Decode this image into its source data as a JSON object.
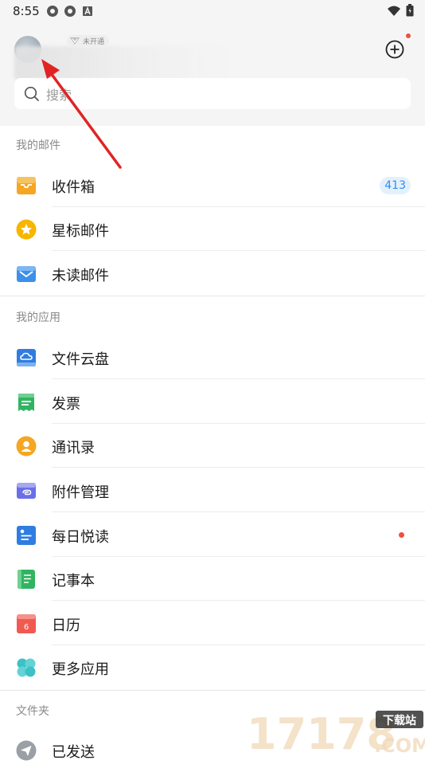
{
  "status_bar": {
    "time": "8:55"
  },
  "header": {
    "vip_badge": "未开通",
    "search_placeholder": "搜索"
  },
  "sections": {
    "my_mail": {
      "title": "我的邮件",
      "items": [
        {
          "label": "收件箱",
          "badge": "413",
          "icon": "inbox-tray-icon",
          "color": "#f5a623"
        },
        {
          "label": "星标邮件",
          "icon": "star-icon",
          "color": "#f7b500"
        },
        {
          "label": "未读邮件",
          "icon": "envelope-icon",
          "color": "#3d8fea"
        }
      ]
    },
    "my_apps": {
      "title": "我的应用",
      "items": [
        {
          "label": "文件云盘",
          "icon": "cloud-drive-icon",
          "color": "#2f7de1"
        },
        {
          "label": "发票",
          "icon": "invoice-icon",
          "color": "#31b461"
        },
        {
          "label": "通讯录",
          "icon": "contacts-icon",
          "color": "#f5a623"
        },
        {
          "label": "附件管理",
          "icon": "attachment-icon",
          "color": "#6a6fe8"
        },
        {
          "label": "每日悦读",
          "icon": "daily-read-icon",
          "color": "#2f7de1",
          "dot": true
        },
        {
          "label": "记事本",
          "icon": "notepad-icon",
          "color": "#31b461"
        },
        {
          "label": "日历",
          "icon": "calendar-icon",
          "color": "#f05a50",
          "icon_text": "6"
        },
        {
          "label": "更多应用",
          "icon": "more-apps-icon",
          "color": "#3cc2c6"
        }
      ]
    },
    "folders": {
      "title": "文件夹",
      "items": [
        {
          "label": "已发送",
          "icon": "sent-icon",
          "color": "#9aa0a6"
        }
      ]
    }
  },
  "watermark": {
    "text": "17178",
    "sub": "下载站",
    "domain": ".COM"
  }
}
